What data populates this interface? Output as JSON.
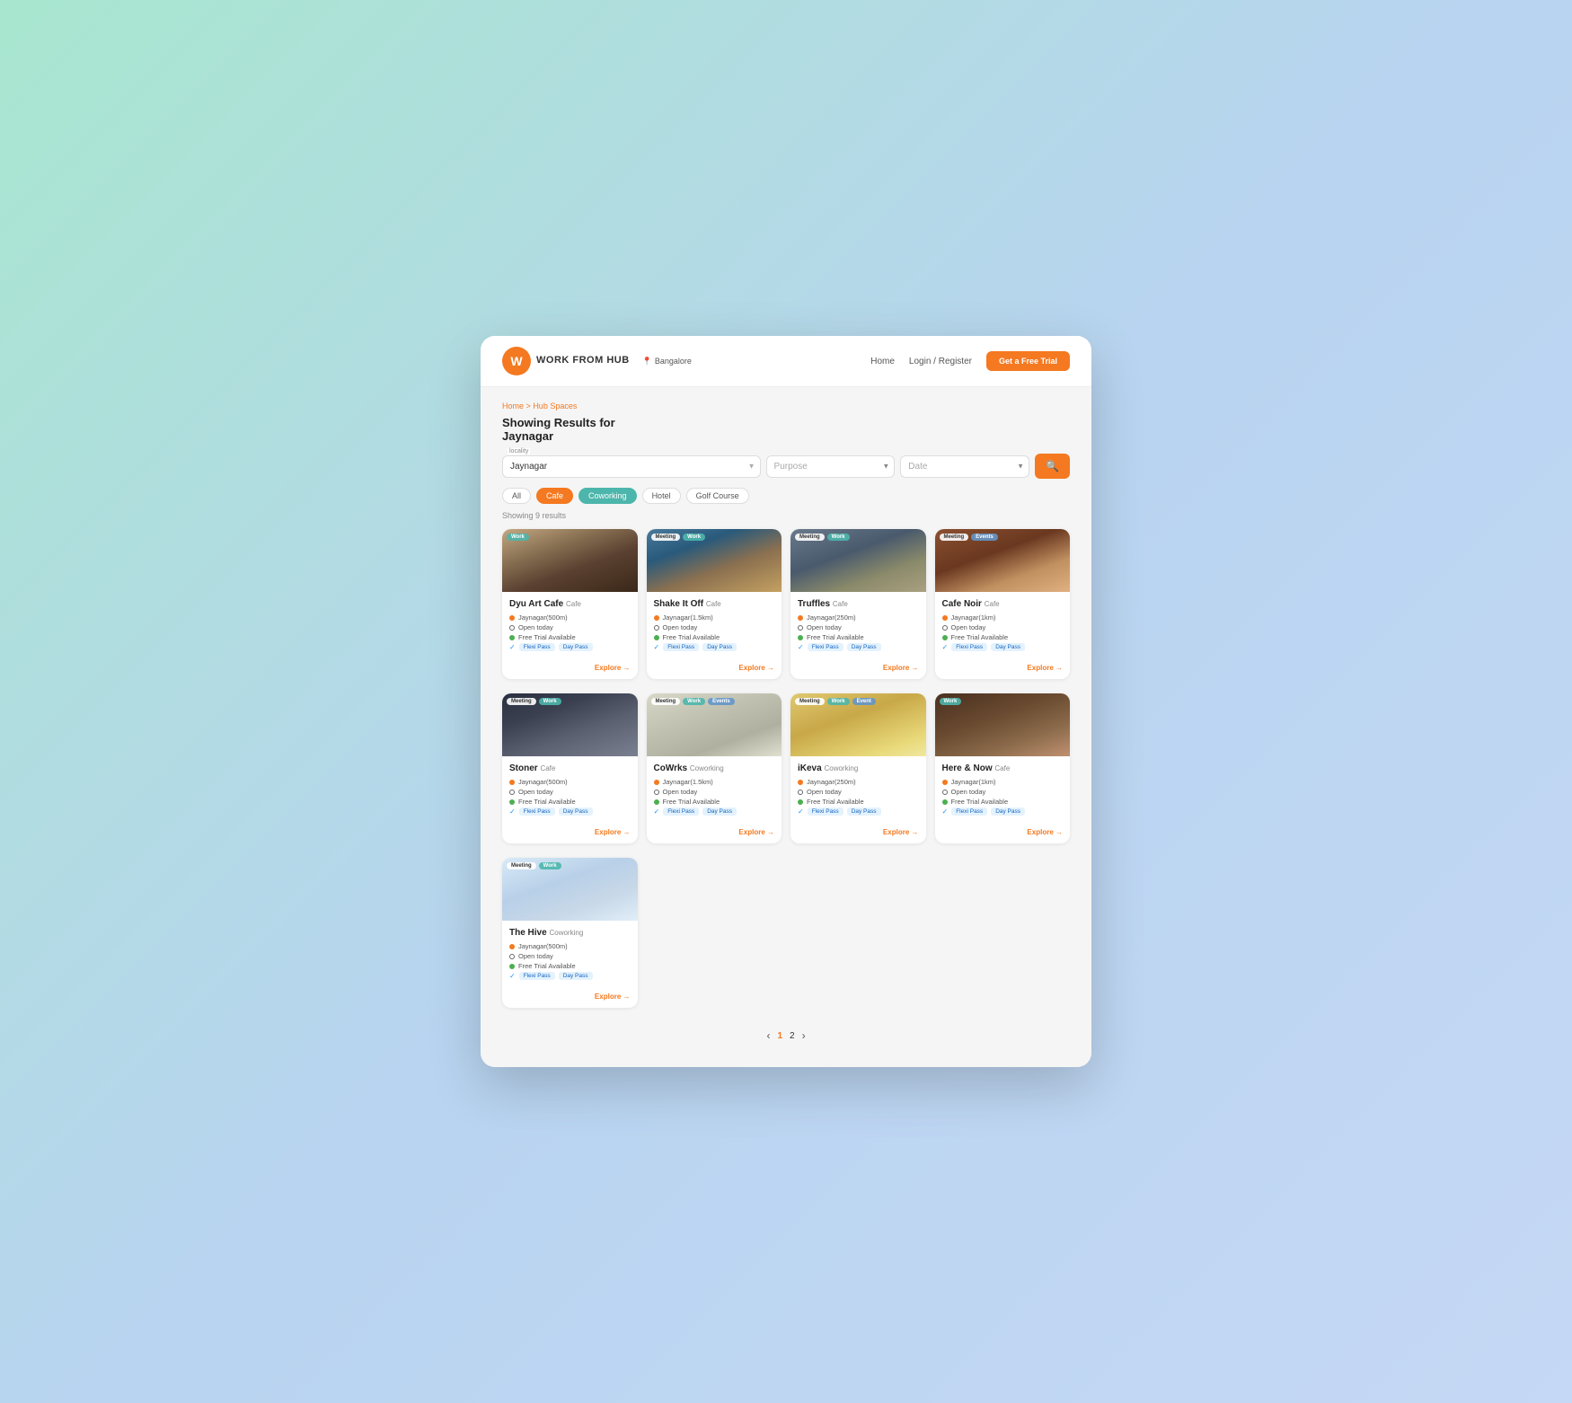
{
  "meta": {
    "bg_gradient_start": "#a8e6cf",
    "bg_gradient_end": "#c5d8f5"
  },
  "nav": {
    "logo_letter": "W",
    "logo_text": "WORK FROM HUB",
    "location": "Bangalore",
    "links": [
      "Home",
      "Login / Register"
    ],
    "cta": "Get a Free Trial"
  },
  "breadcrumb": {
    "home": "Home",
    "separator": ">",
    "current": "Hub Spaces"
  },
  "page": {
    "title": "Showing Results for",
    "subtitle": "Jaynagar"
  },
  "search": {
    "locality_label": "locality",
    "locality_value": "Jaynagar",
    "purpose_placeholder": "Purpose",
    "date_placeholder": "Date",
    "search_button_icon": "🔍"
  },
  "filters": {
    "tabs": [
      {
        "label": "All",
        "state": "default"
      },
      {
        "label": "Cafe",
        "state": "active-orange"
      },
      {
        "label": "Coworking",
        "state": "active-teal"
      },
      {
        "label": "Hotel",
        "state": "default"
      },
      {
        "label": "Golf Course",
        "state": "default"
      }
    ]
  },
  "results": {
    "count": "Showing 9 results"
  },
  "cards": [
    {
      "id": 1,
      "name": "Dyu Art Cafe",
      "type": "Cafe",
      "img_class": "img-dyu",
      "tags": [
        "Work"
      ],
      "location": "Jaynagar(500m)",
      "hours": "Open today",
      "trial": "Free Trial Available",
      "passes": [
        "Flexi Pass",
        "Day Pass"
      ],
      "explore": "Explore"
    },
    {
      "id": 2,
      "name": "Shake It Off",
      "type": "Cafe",
      "img_class": "img-shake",
      "tags": [
        "Meeting",
        "Work"
      ],
      "location": "Jaynagar(1.5km)",
      "hours": "Open today",
      "trial": "Free Trial Available",
      "passes": [
        "Flexi Pass",
        "Day Pass"
      ],
      "explore": "Explore"
    },
    {
      "id": 3,
      "name": "Truffles",
      "type": "Cafe",
      "img_class": "img-truffles",
      "tags": [
        "Meeting",
        "Work"
      ],
      "location": "Jaynagar(250m)",
      "hours": "Open today",
      "trial": "Free Trial Available",
      "passes": [
        "Flexi Pass",
        "Day Pass"
      ],
      "explore": "Explore"
    },
    {
      "id": 4,
      "name": "Cafe Noir",
      "type": "Cafe",
      "img_class": "img-cafenoir",
      "tags": [
        "Meeting",
        "Events"
      ],
      "location": "Jaynagar(1km)",
      "hours": "Open today",
      "trial": "Free Trial Available",
      "passes": [
        "Flexi Pass",
        "Day Pass"
      ],
      "explore": "Explore"
    },
    {
      "id": 5,
      "name": "Stoner",
      "type": "Cafe",
      "img_class": "img-stoner",
      "tags": [
        "Meeting",
        "Work"
      ],
      "location": "Jaynagar(500m)",
      "hours": "Open today",
      "trial": "Free Trial Available",
      "passes": [
        "Flexi Pass",
        "Day Pass"
      ],
      "explore": "Explore"
    },
    {
      "id": 6,
      "name": "CoWrks",
      "type": "Coworking",
      "img_class": "img-cowrks",
      "tags": [
        "Meeting",
        "Work",
        "Events"
      ],
      "location": "Jaynagar(1.5km)",
      "hours": "Open today",
      "trial": "Free Trial Available",
      "passes": [
        "Flexi Pass",
        "Day Pass"
      ],
      "explore": "Explore"
    },
    {
      "id": 7,
      "name": "iKeva",
      "type": "Coworking",
      "img_class": "img-ikeva",
      "tags": [
        "Meeting",
        "Work",
        "Event"
      ],
      "location": "Jaynagar(250m)",
      "hours": "Open today",
      "trial": "Free Trial Available",
      "passes": [
        "Flexi Pass",
        "Day Pass"
      ],
      "explore": "Explore"
    },
    {
      "id": 8,
      "name": "Here & Now",
      "type": "Cafe",
      "img_class": "img-herenow",
      "tags": [
        "Work"
      ],
      "location": "Jaynagar(1km)",
      "hours": "Open today",
      "trial": "Free Trial Available",
      "passes": [
        "Flexi Pass",
        "Day Pass"
      ],
      "explore": "Explore"
    },
    {
      "id": 9,
      "name": "The Hive",
      "type": "Coworking",
      "img_class": "img-hive",
      "tags": [
        "Meeting",
        "Work"
      ],
      "location": "Jaynagar(500m)",
      "hours": "Open today",
      "trial": "Free Trial Available",
      "passes": [
        "Flexi Pass",
        "Day Pass"
      ],
      "explore": "Explore"
    }
  ],
  "pagination": {
    "prev": "‹",
    "pages": [
      "1",
      "2"
    ],
    "next": "›",
    "current": "1"
  }
}
